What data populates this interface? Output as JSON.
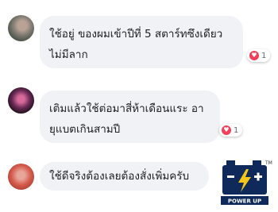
{
  "comments": [
    {
      "lines": [
        "ใช้อยู่ ของผมเข้าปีที่ 5 สตาร์ทซึงเดียว",
        "ไม่มีลาก"
      ],
      "reactions": "1"
    },
    {
      "lines": [
        "เติมแล้วใช้ต่อมาสี่ห้าเดือนแระ อา",
        "ยุแบตเกินสามปี"
      ],
      "reactions": "1"
    },
    {
      "lines": [
        "ใช้ดีจริงต้องเลยต้องสั่งเพิ่มครับ"
      ]
    }
  ],
  "logo": {
    "text": "POWER UP",
    "tm": "TM",
    "icon": "battery-lightning-icon",
    "color": "#0f2a5a"
  },
  "colors": {
    "bubble": "#f0f2f5",
    "heart": "#f33e58"
  }
}
